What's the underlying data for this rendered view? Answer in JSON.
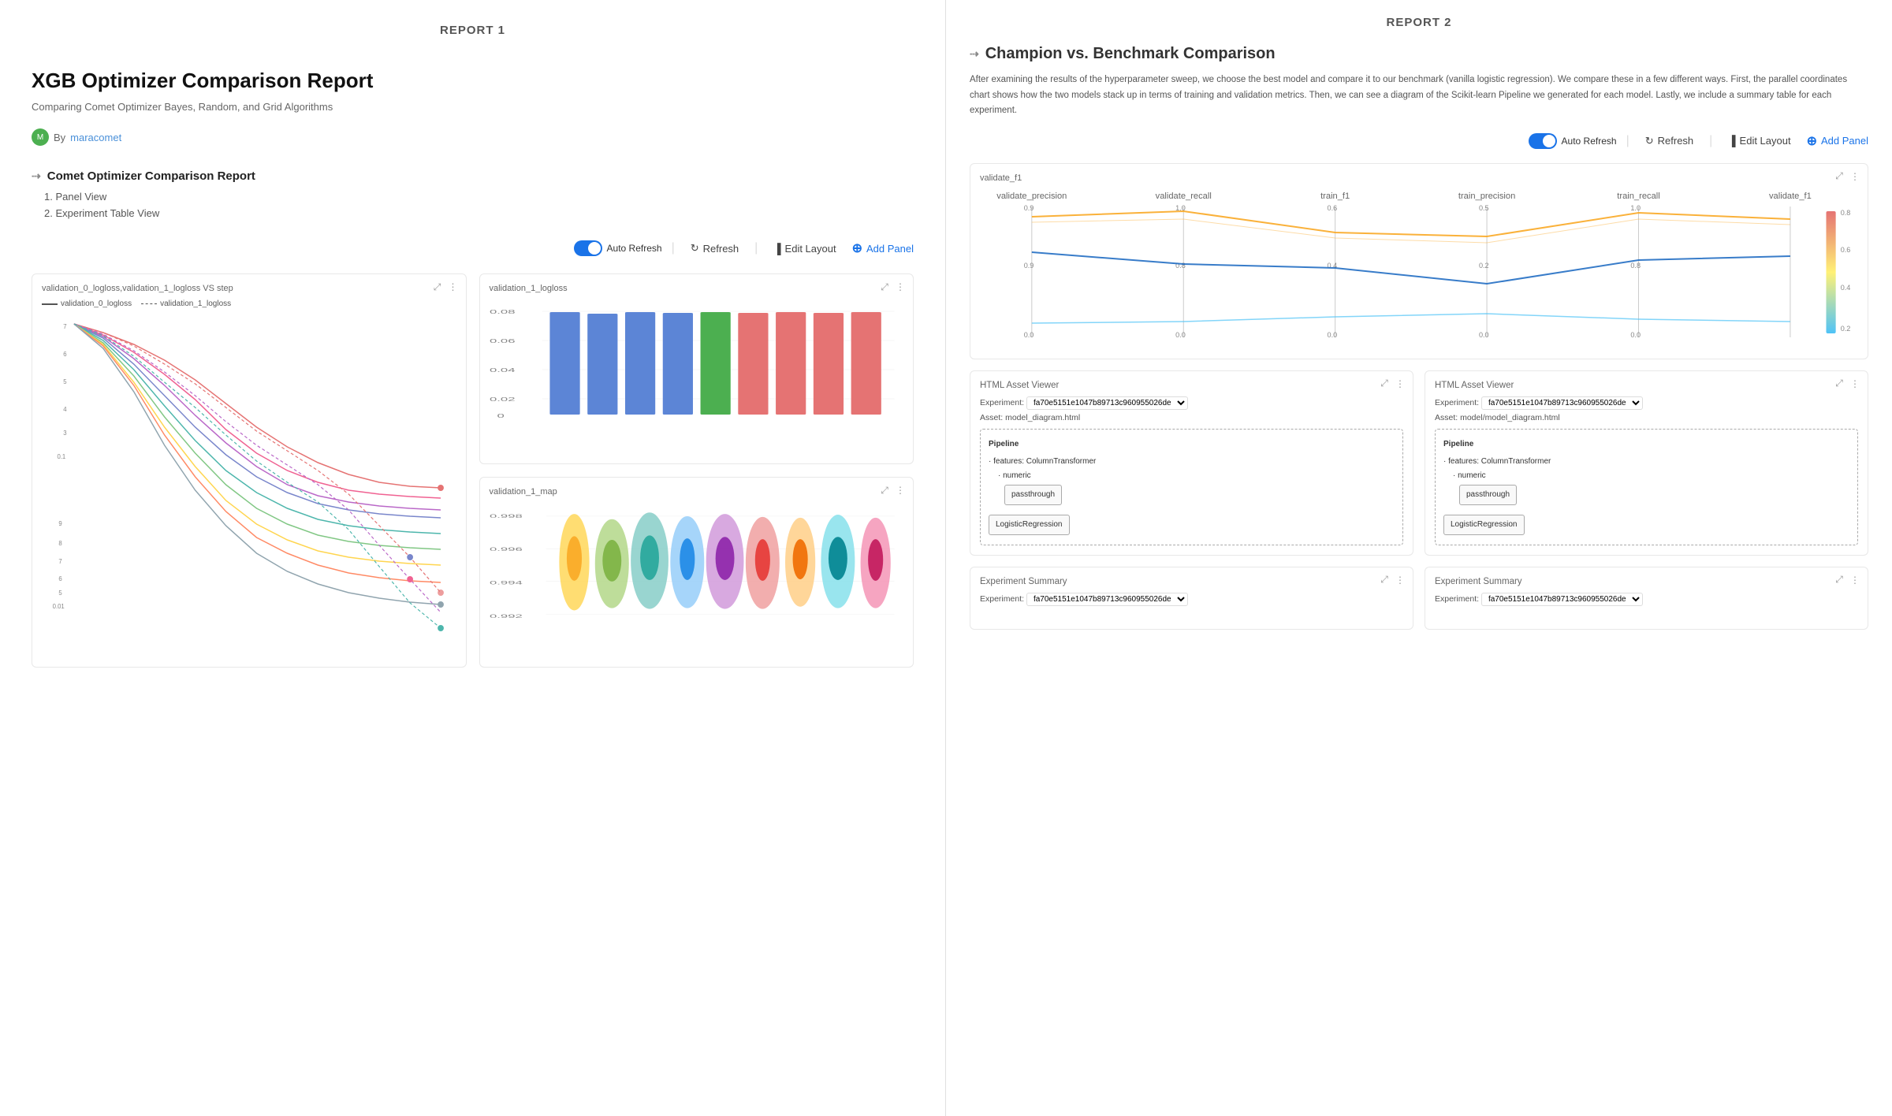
{
  "reports": {
    "report1": {
      "tab_label": "REPORT 1",
      "heading": "XGB Optimizer Comparison Report",
      "subheading": "Comparing Comet Optimizer Bayes, Random, and Grid Algorithms",
      "author_label": "By",
      "author_name": "maracomet",
      "toc_title": "Comet Optimizer Comparison Report",
      "toc_items": [
        "1. Panel View",
        "2. Experiment Table View"
      ],
      "toolbar": {
        "auto_refresh_label": "Auto Refresh",
        "refresh_label": "Refresh",
        "edit_layout_label": "Edit Layout",
        "add_panel_label": "Add Panel"
      },
      "charts": [
        {
          "id": "chart1",
          "title": "validation_0_logloss,validation_1_logloss VS step",
          "type": "line",
          "legend": [
            "validation_0_logloss",
            "validation_1_logloss"
          ]
        },
        {
          "id": "chart2",
          "title": "validation_1_logloss",
          "type": "bar"
        },
        {
          "id": "chart3",
          "title": "validation_1_map",
          "type": "violin"
        }
      ]
    },
    "report2": {
      "tab_label": "REPORT 2",
      "heading": "Champion vs. Benchmark Comparison",
      "description": "After examining the results of the hyperparameter sweep, we choose the best model and compare it to our benchmark (vanilla logistic regression). We compare these in a few different ways. First, the parallel coordinates chart shows how the two models stack up in terms of training and validation metrics. Then, we can see a diagram of the Scikit-learn Pipeline we generated for each model. Lastly, we include a summary table for each experiment.",
      "toolbar": {
        "auto_refresh_label": "Auto Refresh",
        "refresh_label": "Refresh",
        "edit_layout_label": "Edit Layout",
        "add_panel_label": "Add Panel"
      },
      "parallel_chart": {
        "title": "validate_f1",
        "axes": [
          "validate_precision",
          "validate_recall",
          "train_f1",
          "train_precision",
          "train_recall",
          "validate_f1"
        ]
      },
      "html_assets": [
        {
          "title": "HTML Asset Viewer",
          "experiment_label": "Experiment:",
          "experiment_value": "fa70e5151e1047b89713c960955026de",
          "asset_label": "Asset: model_diagram.html",
          "pipeline_title": "Pipeline",
          "pipeline_features": "· features: ColumnTransformer",
          "pipeline_numeric": "· numeric",
          "pipeline_passthrough": "passthrough",
          "pipeline_model": "LogisticRegression"
        },
        {
          "title": "HTML Asset Viewer",
          "experiment_label": "Experiment:",
          "experiment_value": "fa70e5151e1047b89713c960955026de",
          "asset_label": "Asset: model/model_diagram.html",
          "pipeline_title": "Pipeline",
          "pipeline_features": "· features: ColumnTransformer",
          "pipeline_numeric": "· numeric",
          "pipeline_passthrough": "passthrough",
          "pipeline_model": "LogisticRegression"
        }
      ],
      "exp_summaries": [
        {
          "title": "Experiment Summary",
          "experiment_label": "Experiment:",
          "experiment_value": "fa70e5151e1047b89713c960955026de"
        },
        {
          "title": "Experiment Summary",
          "experiment_label": "Experiment:",
          "experiment_value": "fa70e5151e1047b89713c960955026de"
        }
      ]
    }
  },
  "icons": {
    "refresh": "↻",
    "edit": "▐",
    "add": "+",
    "link": "⇢",
    "expand": "⤢",
    "dots": "⋮"
  },
  "colors": {
    "primary_blue": "#1a73e8",
    "toggle_blue": "#1a73e8",
    "line_colors": [
      "#e57373",
      "#f06292",
      "#ba68c8",
      "#7986cb",
      "#4db6ac",
      "#81c784",
      "#aed581",
      "#ff8a65",
      "#90a4ae",
      "#ffd54f",
      "#4fc3f7",
      "#a1887f",
      "#e91e63",
      "#3f51b5",
      "#009688"
    ],
    "bar_colors": [
      "#5c85d6",
      "#5c85d6",
      "#5c85d6",
      "#5c85d6",
      "#4caf50",
      "#e57373",
      "#e57373",
      "#e57373",
      "#e57373"
    ],
    "violin_colors": [
      "#ffd54f",
      "#aed581",
      "#80cbc4",
      "#90caf9",
      "#ce93d8",
      "#ef9a9a",
      "#ffcc80",
      "#80deea",
      "#f48fb1"
    ],
    "parallel_line1": "#f9a825",
    "parallel_line2": "#1565c0"
  }
}
